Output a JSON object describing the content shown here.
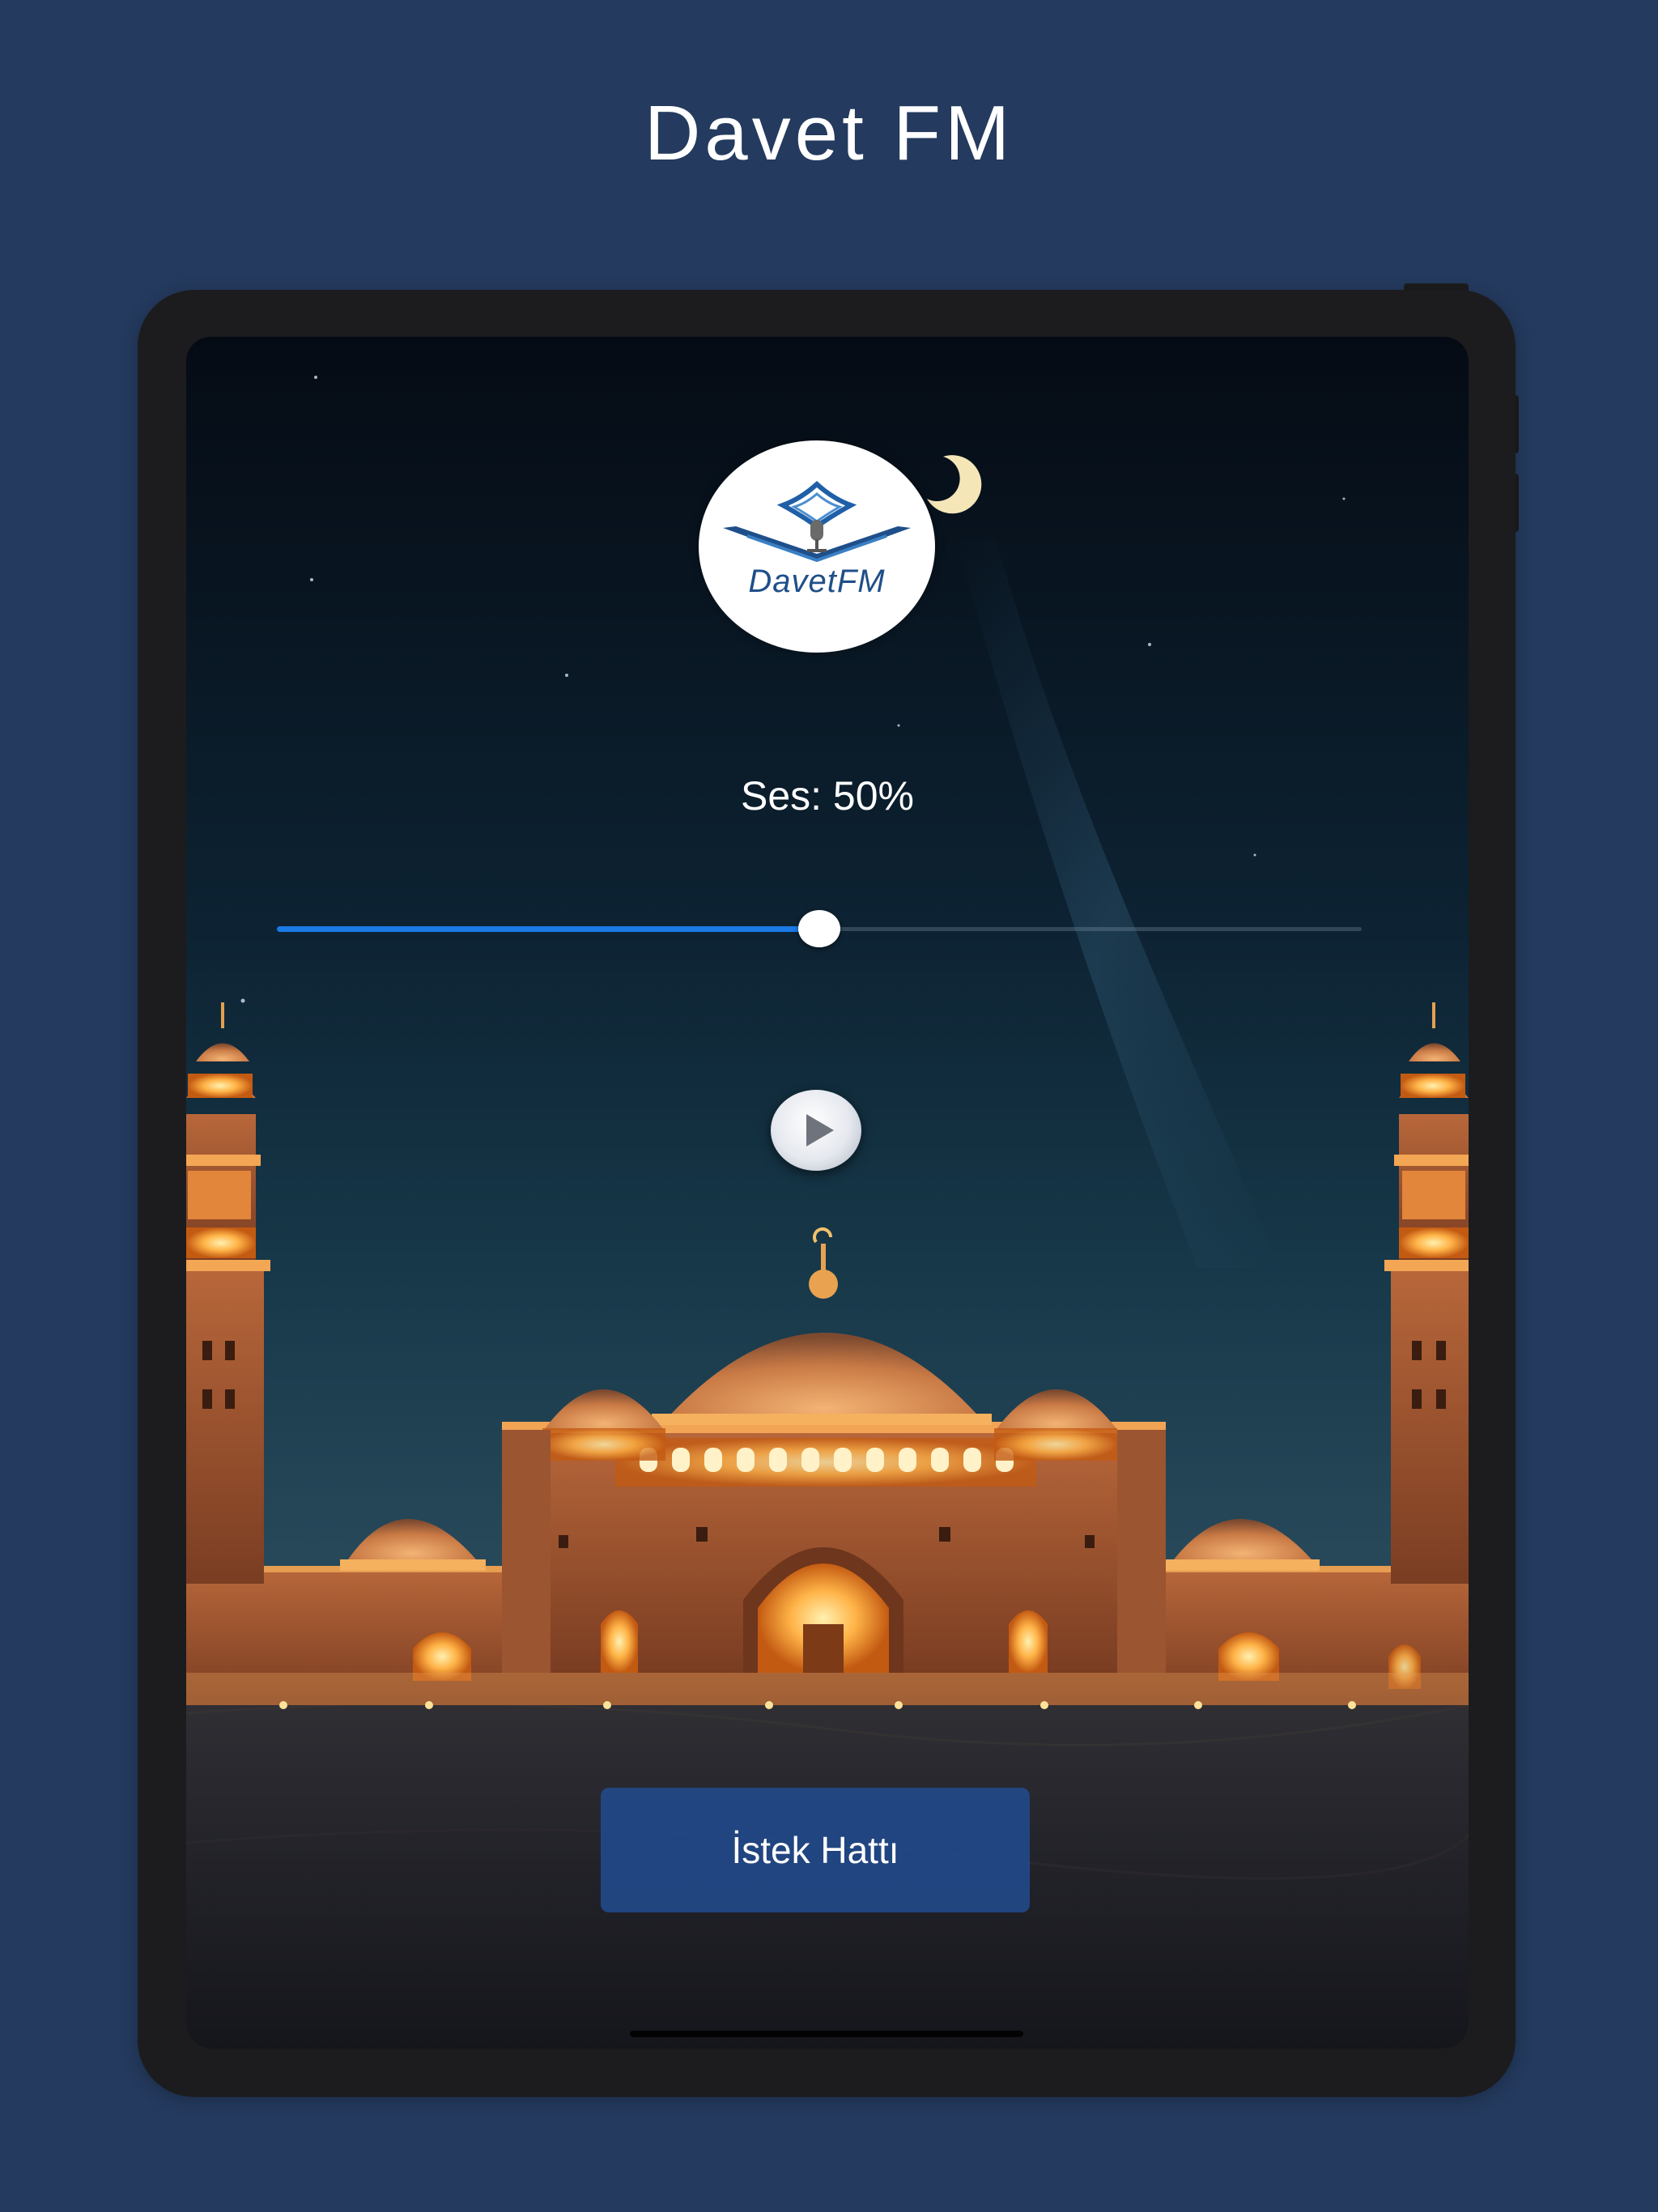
{
  "promo": {
    "title": "Davet FM"
  },
  "app": {
    "logo": {
      "text": "DavetFM",
      "icon": "book-microphone-logo"
    },
    "volume": {
      "label": "Ses: 50%",
      "value": 0.5
    },
    "play": {
      "icon": "play-icon"
    },
    "request_button": {
      "label": "İstek Hattı"
    }
  },
  "colors": {
    "page_background": "#243a5e",
    "slider_accent": "#1a7ae6",
    "button_background": "#214a8c",
    "logo_blue": "#1f4f8a"
  }
}
